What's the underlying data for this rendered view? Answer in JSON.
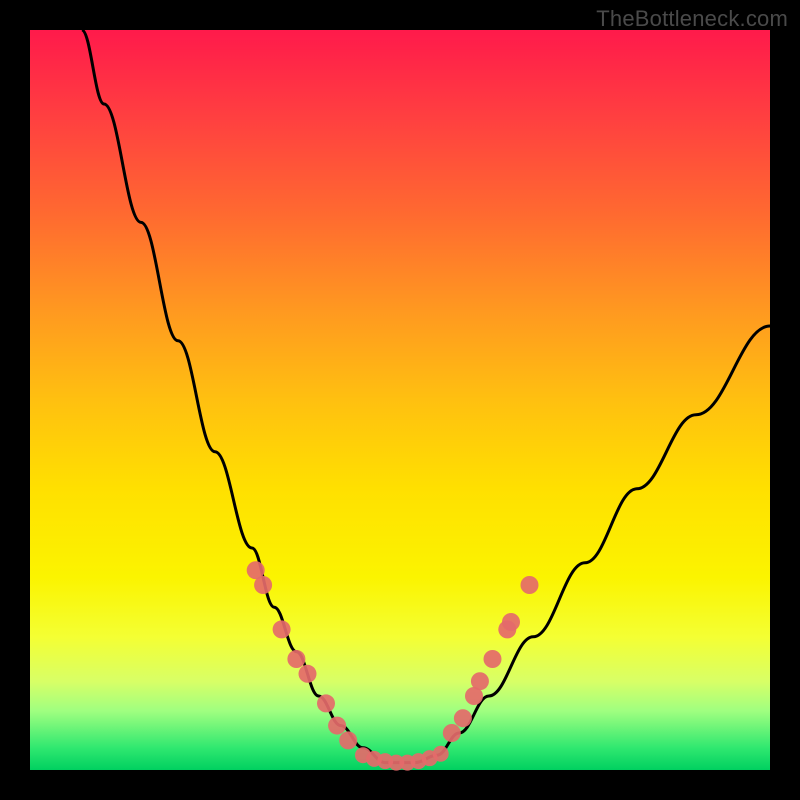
{
  "watermark": "TheBottleneck.com",
  "colors": {
    "frame": "#000000",
    "curve": "#000000",
    "dots": "#e46a6a",
    "gradient_top": "#ff1a4b",
    "gradient_bottom": "#00d060"
  },
  "chart_data": {
    "type": "line",
    "title": "",
    "xlabel": "",
    "ylabel": "",
    "xlim": [
      0,
      100
    ],
    "ylim": [
      0,
      100
    ],
    "note": "Axes are normalized 0-100; numeric values below estimated from pixel positions because the chart has no visible tick labels.",
    "series": [
      {
        "name": "bottleneck-curve",
        "x": [
          7,
          10,
          15,
          20,
          25,
          30,
          33,
          36,
          39,
          42,
          45,
          48,
          50,
          52,
          55,
          58,
          62,
          68,
          75,
          82,
          90,
          100
        ],
        "y": [
          100,
          90,
          74,
          58,
          43,
          30,
          22,
          16,
          10,
          6,
          3,
          1,
          1,
          1,
          2,
          5,
          10,
          18,
          28,
          38,
          48,
          60
        ]
      }
    ],
    "dots_left": [
      {
        "x": 30.5,
        "y": 27
      },
      {
        "x": 31.5,
        "y": 25
      },
      {
        "x": 34.0,
        "y": 19
      },
      {
        "x": 36.0,
        "y": 15
      },
      {
        "x": 37.5,
        "y": 13
      },
      {
        "x": 40.0,
        "y": 9
      },
      {
        "x": 41.5,
        "y": 6
      },
      {
        "x": 43.0,
        "y": 4
      }
    ],
    "dots_bottom": [
      {
        "x": 45.0,
        "y": 2.0
      },
      {
        "x": 46.5,
        "y": 1.5
      },
      {
        "x": 48.0,
        "y": 1.2
      },
      {
        "x": 49.5,
        "y": 1.0
      },
      {
        "x": 51.0,
        "y": 1.0
      },
      {
        "x": 52.5,
        "y": 1.2
      },
      {
        "x": 54.0,
        "y": 1.6
      },
      {
        "x": 55.5,
        "y": 2.2
      }
    ],
    "dots_right": [
      {
        "x": 57.0,
        "y": 5
      },
      {
        "x": 58.5,
        "y": 7
      },
      {
        "x": 60.0,
        "y": 10
      },
      {
        "x": 60.8,
        "y": 12
      },
      {
        "x": 62.5,
        "y": 15
      },
      {
        "x": 64.5,
        "y": 19
      },
      {
        "x": 65.0,
        "y": 20
      },
      {
        "x": 67.5,
        "y": 25
      }
    ]
  }
}
